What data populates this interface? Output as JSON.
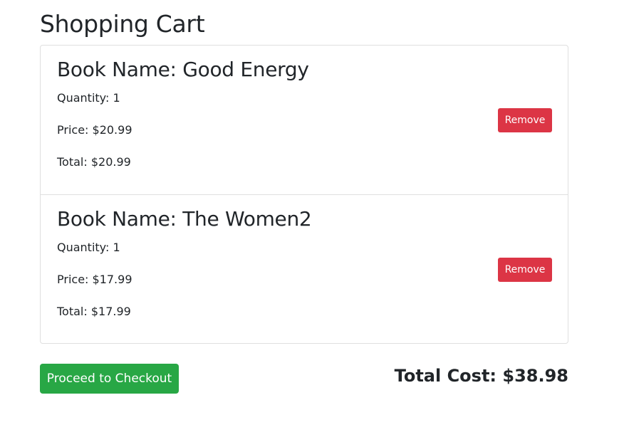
{
  "page": {
    "title": "Shopping Cart"
  },
  "cart": {
    "items": [
      {
        "name": "Book Name: Good Energy",
        "quantity": "Quantity: 1",
        "price": "Price: $20.99",
        "total": "Total: $20.99",
        "remove_label": "Remove"
      },
      {
        "name": "Book Name: The Women2",
        "quantity": "Quantity: 1",
        "price": "Price: $17.99",
        "total": "Total: $17.99",
        "remove_label": "Remove"
      }
    ]
  },
  "footer": {
    "checkout_label": "Proceed to Checkout",
    "total_cost": "Total Cost: $38.98"
  },
  "colors": {
    "remove_button": "#dc3545",
    "checkout_button": "#28a745",
    "text": "#212529",
    "border": "#dfdfdf"
  }
}
